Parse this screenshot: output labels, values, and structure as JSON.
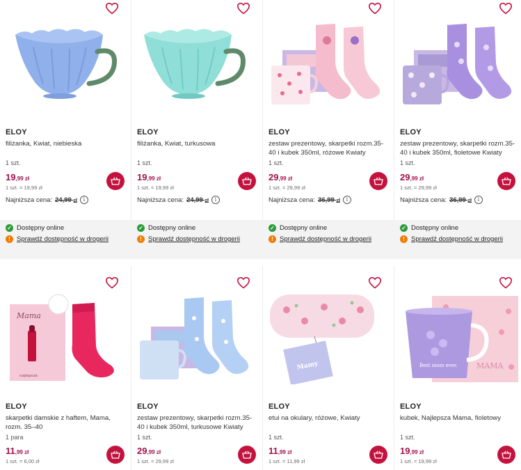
{
  "colors": {
    "price": "#a3114a",
    "cart": "#c4123f",
    "available": "#2e9b3a",
    "check_store": "#ef7d00"
  },
  "products": [
    {
      "brand": "ELOY",
      "name": "filiżanka, Kwiat, niebieska",
      "qty": "1 szt.",
      "price_main": "19",
      "price_fraction": ",99 zł",
      "unit_price": "1 szt. = 19,99 zł",
      "lowest_label": "Najniższa cena:",
      "lowest_main": "24,99",
      "lowest_currency": "zł",
      "available": "Dostępny online",
      "check_store": "Sprawdź dostępność w drogerii",
      "image": "blue-cup"
    },
    {
      "brand": "ELOY",
      "name": "filiżanka, Kwiat, turkusowa",
      "qty": "1 szt.",
      "price_main": "19",
      "price_fraction": ",99 zł",
      "unit_price": "1 szt. = 19,99 zł",
      "lowest_label": "Najniższa cena:",
      "lowest_main": "24,99",
      "lowest_currency": "zł",
      "available": "Dostępny online",
      "check_store": "Sprawdź dostępność w drogerii",
      "image": "turquoise-cup"
    },
    {
      "brand": "ELOY",
      "name": "zestaw prezentowy, skarpetki rozm.35-40 i kubek 350ml, różowe Kwiaty",
      "qty": "1 szt.",
      "price_main": "29",
      "price_fraction": ",99 zł",
      "unit_price": "1 szt. = 29,99 zł",
      "lowest_label": "Najniższa cena:",
      "lowest_main": "36,99",
      "lowest_currency": "zł",
      "available": "Dostępny online",
      "check_store": "Sprawdź dostępność w drogerii",
      "image": "pink-gift-set"
    },
    {
      "brand": "ELOY",
      "name": "zestaw prezentowy, skarpetki rozm.35-40 i kubek 350ml, fioletowe Kwiaty",
      "qty": "1 szt.",
      "price_main": "29",
      "price_fraction": ",99 zł",
      "unit_price": "1 szt. = 29,99 zł",
      "lowest_label": "Najniższa cena:",
      "lowest_main": "36,99",
      "lowest_currency": "zł",
      "available": "Dostępny online",
      "check_store": "Sprawdź dostępność w drogerii",
      "image": "purple-gift-set"
    },
    {
      "brand": "ELOY",
      "name": "skarpetki damskie z haftem, Mama, rozm. 35–40",
      "qty": "1 para",
      "price_main": "11",
      "price_fraction": ",99 zł",
      "unit_price": "1 szt. = 6,00 zł",
      "image": "mama-socks"
    },
    {
      "brand": "ELOY",
      "name": "zestaw prezentowy, skarpetki rozm.35-40 i kubek 350ml, turkusowe Kwiaty",
      "qty": "1 szt.",
      "price_main": "29",
      "price_fraction": ",99 zł",
      "unit_price": "1 szt. = 29,99 zł",
      "image": "blue-gift-set"
    },
    {
      "brand": "ELOY",
      "name": "etui na okulary, różowe, Kwiaty",
      "qty": "1 szt.",
      "price_main": "11",
      "price_fraction": ",99 zł",
      "unit_price": "1 szt. = 11,99 zł",
      "image": "glasses-case"
    },
    {
      "brand": "ELOY",
      "name": "kubek, Najlepsza Mama, fioletowy",
      "qty": "1 szt.",
      "price_main": "19",
      "price_fraction": ",99 zł",
      "unit_price": "1 szt. = 19,99 zł",
      "image": "mama-mug"
    }
  ],
  "image_text": {
    "mama_card": "Mama",
    "mama_card_sub": "najlepsza",
    "glasses_tag": "Mamy",
    "mug_text": "Best mom ever.",
    "box_text": "MAMA"
  }
}
